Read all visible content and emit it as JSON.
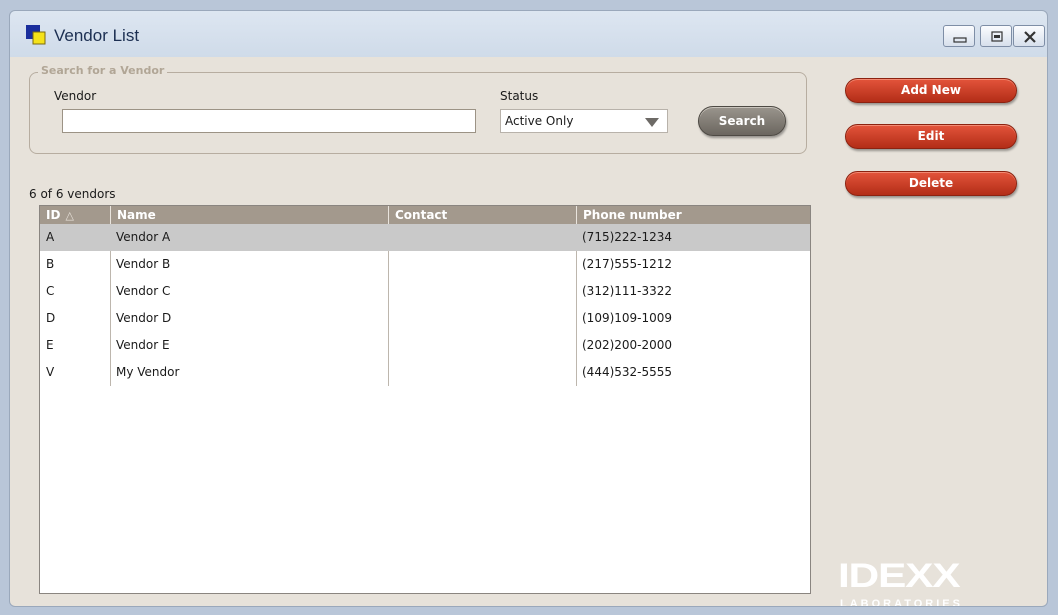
{
  "window": {
    "title": "Vendor List"
  },
  "search": {
    "legend": "Search for a Vendor",
    "vendor_label": "Vendor",
    "vendor_value": "",
    "status_label": "Status",
    "status_value": "Active Only",
    "search_label": "Search"
  },
  "list": {
    "count_text": "6 of 6 vendors",
    "columns": [
      "ID",
      "Name",
      "Contact",
      "Phone number"
    ],
    "sorted_column": "ID",
    "sort_direction": "ascending",
    "selected_row": 0,
    "rows": [
      {
        "id": "A",
        "name": "Vendor A",
        "contact": "",
        "phone": "(715)222-1234"
      },
      {
        "id": "B",
        "name": "Vendor B",
        "contact": "",
        "phone": "(217)555-1212"
      },
      {
        "id": "C",
        "name": "Vendor C",
        "contact": "",
        "phone": "(312)111-3322"
      },
      {
        "id": "D",
        "name": "Vendor D",
        "contact": "",
        "phone": "(109)109-1009"
      },
      {
        "id": "E",
        "name": "Vendor E",
        "contact": "",
        "phone": "(202)200-2000"
      },
      {
        "id": "V",
        "name": "My Vendor",
        "contact": "",
        "phone": "(444)532-5555"
      }
    ]
  },
  "actions": {
    "add_new": "Add New",
    "edit": "Edit",
    "delete": "Delete"
  },
  "logo": {
    "main": "IDEXX",
    "sub": "LABORATORIES"
  },
  "icons": [
    "app-icon",
    "minimize-icon",
    "maximize-icon",
    "close-icon",
    "dropdown-arrow-icon",
    "sort-ascending-icon"
  ],
  "colors": {
    "action_button": "#c8381f",
    "search_button": "#7d786f",
    "table_header": "#a3998d",
    "selected_row": "#c9c9c9"
  }
}
